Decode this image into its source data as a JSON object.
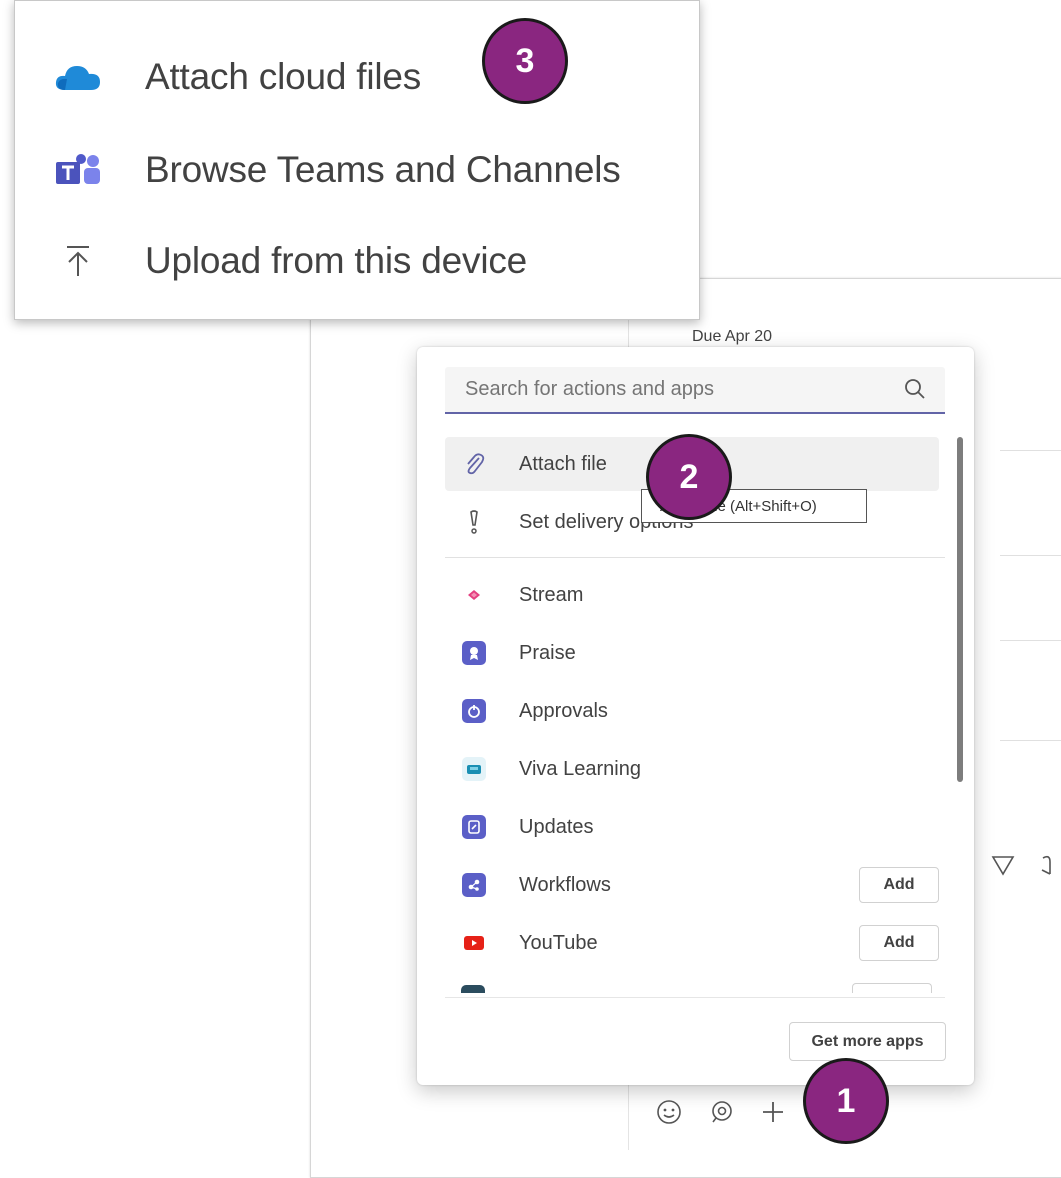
{
  "attach_menu": {
    "items": [
      {
        "label": "Attach cloud files",
        "icon": "onedrive-cloud-icon"
      },
      {
        "label": "Browse Teams and Channels",
        "icon": "teams-icon"
      },
      {
        "label": "Upload from this device",
        "icon": "upload-icon"
      }
    ]
  },
  "background": {
    "due_text": "Due Apr 20"
  },
  "apps_popup": {
    "search_placeholder": "Search for actions and apps",
    "actions": [
      {
        "label": "Attach file",
        "icon": "paperclip-icon"
      },
      {
        "label": "Set delivery options",
        "icon": "exclamation-icon"
      }
    ],
    "apps": [
      {
        "label": "Stream",
        "icon": "stream-icon",
        "color": "#e43f80"
      },
      {
        "label": "Praise",
        "icon": "praise-icon",
        "color": "#5b5fc7"
      },
      {
        "label": "Approvals",
        "icon": "approvals-icon",
        "color": "#5b5fc7"
      },
      {
        "label": "Viva Learning",
        "icon": "viva-learning-icon",
        "color": "#1a8fb3"
      },
      {
        "label": "Updates",
        "icon": "updates-icon",
        "color": "#5b5fc7"
      },
      {
        "label": "Workflows",
        "icon": "workflows-icon",
        "color": "#5b5fc7",
        "action": "Add"
      },
      {
        "label": "YouTube",
        "icon": "youtube-icon",
        "color": "#e62117",
        "action": "Add"
      }
    ],
    "more_apps_label": "Get more apps"
  },
  "tooltip": {
    "text": "Attach file (Alt+Shift+O)"
  },
  "badges": {
    "one": "1",
    "two": "2",
    "three": "3"
  },
  "colors": {
    "accent": "#6264a7",
    "badge": "#8a2680"
  }
}
